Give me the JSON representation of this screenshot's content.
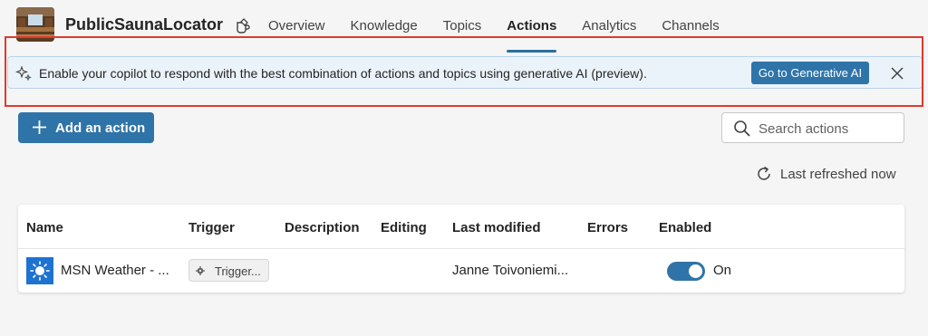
{
  "header": {
    "bot_name": "PublicSaunaLocator",
    "tabs": [
      {
        "label": "Overview"
      },
      {
        "label": "Knowledge"
      },
      {
        "label": "Topics"
      },
      {
        "label": "Actions",
        "active": true
      },
      {
        "label": "Analytics"
      },
      {
        "label": "Channels"
      }
    ]
  },
  "banner": {
    "text": "Enable your copilot to respond with the best combination of actions and topics using generative AI (preview).",
    "button_label": "Go to Generative AI",
    "icon": "sparkle-icon",
    "close_icon": "close-icon"
  },
  "toolbar": {
    "add_label": "Add an action",
    "search_placeholder": "Search actions",
    "refresh_text": "Last refreshed now"
  },
  "table": {
    "columns": [
      "Name",
      "Trigger",
      "Description",
      "Editing",
      "Last modified",
      "Errors",
      "Enabled"
    ],
    "rows": [
      {
        "name": "MSN Weather - ...",
        "trigger": "Trigger...",
        "description": "",
        "editing": "",
        "last_modified": "Janne Toivoniemi...",
        "errors": "",
        "enabled_label": "On",
        "enabled": true,
        "icon": "weather-sun-icon"
      }
    ]
  },
  "colors": {
    "accent": "#2f74a8",
    "banner_bg": "#ebf3fa",
    "highlight": "#e03a2c"
  }
}
